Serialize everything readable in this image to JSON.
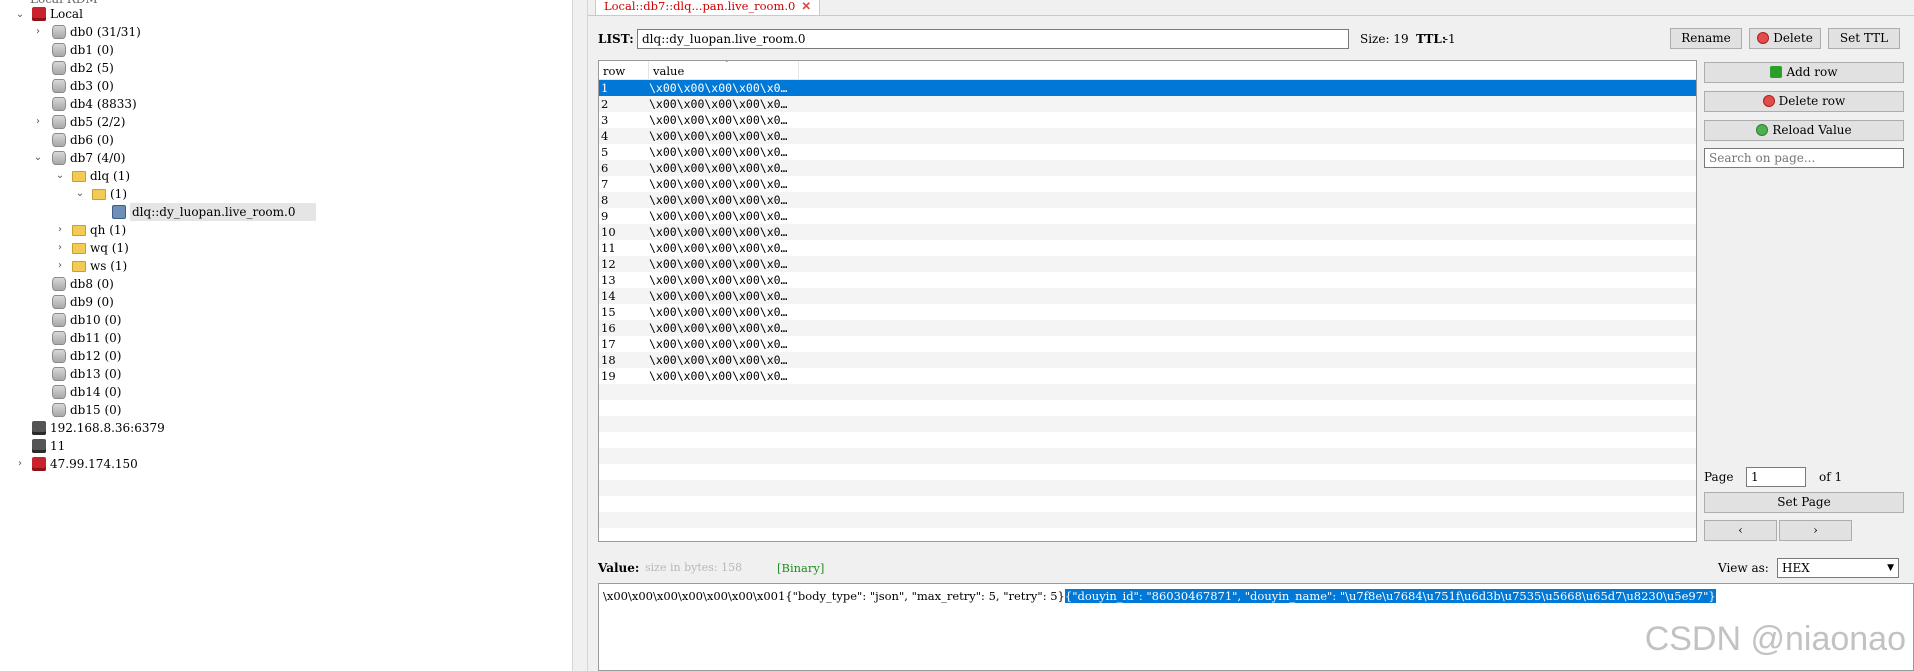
{
  "tree": {
    "top_partial": "Local RDM",
    "local": {
      "label": "Local"
    },
    "dbs": [
      {
        "label": "db0  (31/31)"
      },
      {
        "label": "db1  (0)"
      },
      {
        "label": "db2  (5)"
      },
      {
        "label": "db3  (0)"
      },
      {
        "label": "db4  (8833)"
      },
      {
        "label": "db5  (2/2)"
      },
      {
        "label": "db6  (0)"
      },
      {
        "label": "db7  (4/0)"
      },
      {
        "label": "db8  (0)"
      },
      {
        "label": "db9  (0)"
      },
      {
        "label": "db10  (0)"
      },
      {
        "label": "db11  (0)"
      },
      {
        "label": "db12  (0)"
      },
      {
        "label": "db13  (0)"
      },
      {
        "label": "db14  (0)"
      },
      {
        "label": "db15  (0)"
      }
    ],
    "db7_children": {
      "dlq": "dlq (1)",
      "empty": " (1)",
      "key": "dlq::dy_luopan.live_room.0",
      "qh": "qh (1)",
      "wq": "wq (1)",
      "ws": "ws (1)"
    },
    "servers": [
      {
        "label": "192.168.8.36:6379",
        "icon": "server-grey-icon"
      },
      {
        "label": "11",
        "icon": "server-grey-icon"
      },
      {
        "label": "47.99.174.150",
        "icon": "server-red-icon"
      }
    ]
  },
  "tab": {
    "label": "Local::db7::dlq...pan.live_room.0"
  },
  "keybar": {
    "type_label": "LIST:",
    "key_name": "dlq::dy_luopan.live_room.0",
    "size_text": "Size: 19",
    "ttl_label": "TTL:",
    "ttl_value": "-1",
    "rename": "Rename",
    "delete": "Delete",
    "set_ttl": "Set TTL"
  },
  "table": {
    "columns": [
      "row",
      "value"
    ],
    "row_value": "\\x00\\x00\\x00\\x00\\x0…",
    "rows": [
      "1",
      "2",
      "3",
      "4",
      "5",
      "6",
      "7",
      "8",
      "9",
      "10",
      "11",
      "12",
      "13",
      "14",
      "15",
      "16",
      "17",
      "18",
      "19"
    ],
    "selected_row": "1"
  },
  "side": {
    "add_row": "Add row",
    "delete_row": "Delete row",
    "reload_value": "Reload Value",
    "search_placeholder": "Search on page...",
    "page_label": "Page",
    "page_value": "1",
    "of_label": "of 1",
    "set_page": "Set Page",
    "prev": "‹",
    "next": "›"
  },
  "value": {
    "label": "Value:",
    "size_hint": "size in bytes: 158",
    "binary_tag": "[Binary]",
    "view_as_label": "View as:",
    "view_as_value": "HEX",
    "text_plain": "\\x00\\x00\\x00\\x00\\x00\\x00\\x001{\"body_type\": \"json\", \"max_retry\": 5, \"retry\": 5}",
    "text_selected": "{\"douyin_id\": \"86030467871\", \"douyin_name\": \"\\u7f8e\\u7684\\u751f\\u6d3b\\u7535\\u5668\\u65d7\\u8230\\u5e97\"}"
  },
  "watermark": "CSDN @niaonao",
  "colors": {
    "selection": "#0078d7",
    "tab_text": "#cc0000",
    "binary_tag": "#1f8f1f"
  }
}
